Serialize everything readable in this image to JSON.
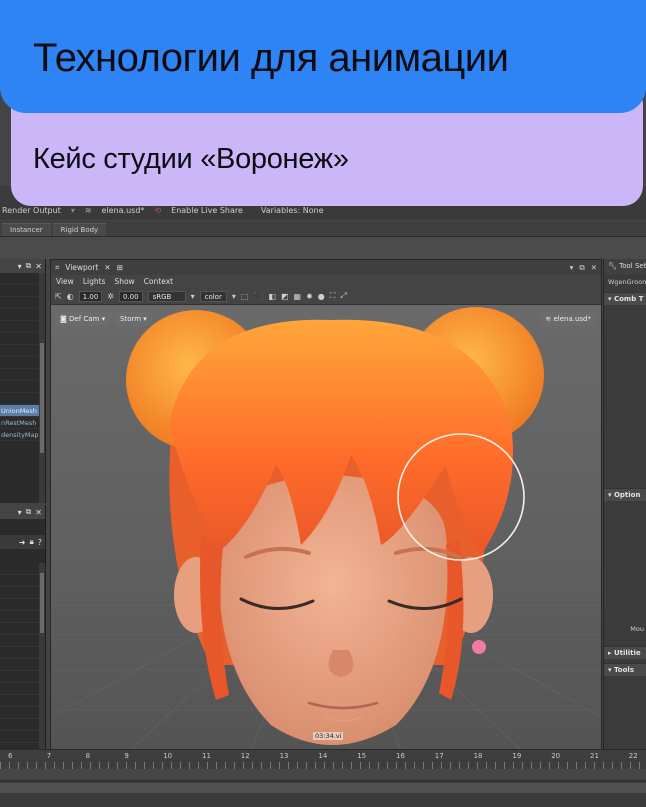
{
  "banner": {
    "title": "Технологии для анимации",
    "subtitle": "Кейс студии «Воронеж»",
    "colors": {
      "blue": "#2f84f5",
      "purple": "#cbb7f7"
    }
  },
  "toolbar": {
    "render_output": "Render Output",
    "file_name": "elena.usd*",
    "live_share": "Enable Live Share",
    "variables": "Variables: None"
  },
  "shelf": {
    "tabs": [
      "Instancer",
      "Rigid Body"
    ]
  },
  "outliner": {
    "items": [
      {
        "label": "",
        "selected": false
      },
      {
        "label": "",
        "selected": false
      },
      {
        "label": "",
        "selected": false
      },
      {
        "label": "",
        "selected": false
      },
      {
        "label": "",
        "selected": false
      },
      {
        "label": "",
        "selected": false
      },
      {
        "label": "",
        "selected": false
      },
      {
        "label": "",
        "selected": false
      },
      {
        "label": "",
        "selected": false
      },
      {
        "label": "",
        "selected": false
      },
      {
        "label": "",
        "selected": false
      },
      {
        "label": "UnionMesh",
        "selected": true
      },
      {
        "label": "nRestMesh",
        "selected": false
      },
      {
        "label": "densityMap",
        "selected": false
      }
    ]
  },
  "viewport": {
    "title": "Viewport",
    "menu": [
      "View",
      "Lights",
      "Show",
      "Context"
    ],
    "exposure": "1.00",
    "gamma": "0.00",
    "color_space": "sRGB",
    "display_mode": "color",
    "camera": "Def Cam",
    "renderer": "Storm",
    "stage": "elena.usd*",
    "timecode": "03:34.vi"
  },
  "tool_settings": {
    "title": "Tool Settings",
    "context": "WgenGroom",
    "sections": [
      "Comb T",
      "Option",
      "Utilitie",
      "Tools"
    ],
    "misc_label": "Mou"
  },
  "timeline": {
    "labels": [
      "6",
      "7",
      "8",
      "9",
      "10",
      "11",
      "12",
      "13",
      "14",
      "15",
      "16",
      "17",
      "18",
      "19",
      "20",
      "21",
      "22"
    ]
  }
}
